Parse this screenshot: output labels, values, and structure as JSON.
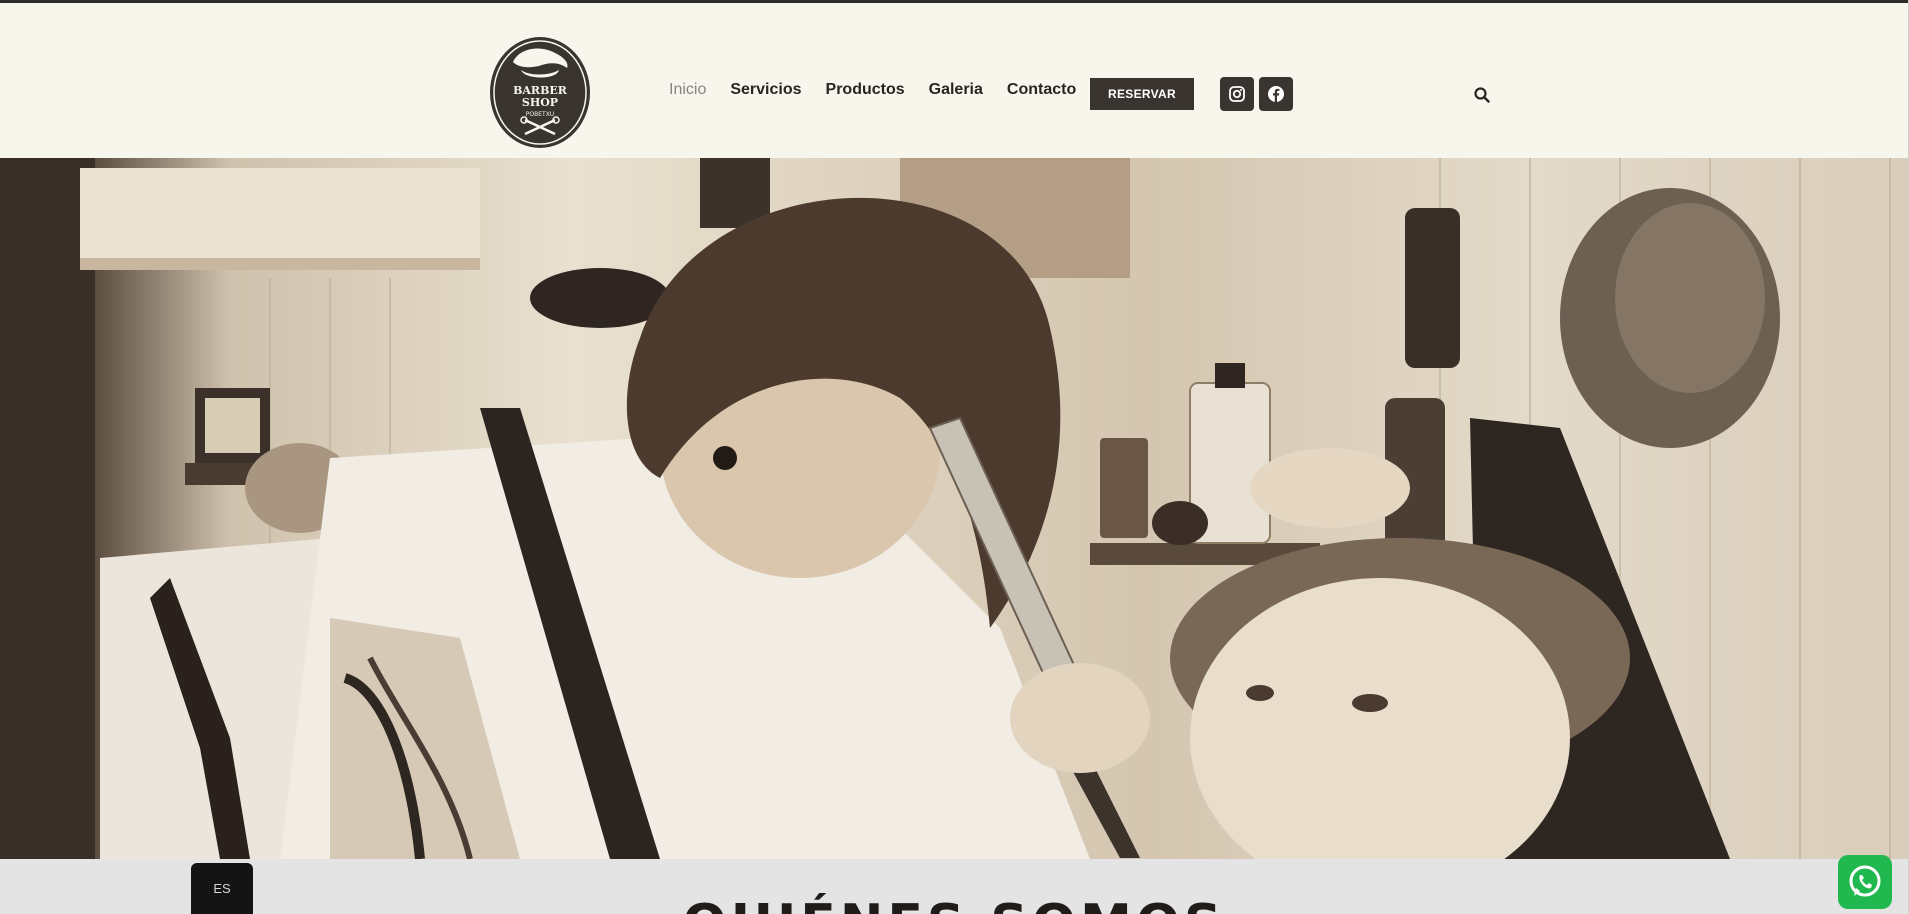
{
  "brand": {
    "logo_text_line1": "BARBER",
    "logo_text_line2": "SHOP",
    "logo_text_line3": "POBETXU"
  },
  "nav": {
    "items": [
      {
        "label": "Inicio",
        "active": true
      },
      {
        "label": "Servicios",
        "active": false
      },
      {
        "label": "Productos",
        "active": false
      },
      {
        "label": "Galeria",
        "active": false
      },
      {
        "label": "Contacto",
        "active": false
      }
    ],
    "cta_label": "RESERVAR"
  },
  "social": {
    "instagram_icon": "instagram-icon",
    "facebook_icon": "facebook-icon"
  },
  "search": {
    "icon": "search-icon"
  },
  "hero": {
    "image": "barber-shaving-customer-sepia-photo"
  },
  "about": {
    "title": "QUIÉNES SOMOS"
  },
  "language": {
    "current": "ES"
  },
  "whatsapp": {
    "icon": "whatsapp-icon"
  },
  "colors": {
    "header_bg": "#f6f6ec",
    "dark": "#3a3431",
    "nav_active": "#8a857f",
    "whatsapp": "#21b94f"
  }
}
